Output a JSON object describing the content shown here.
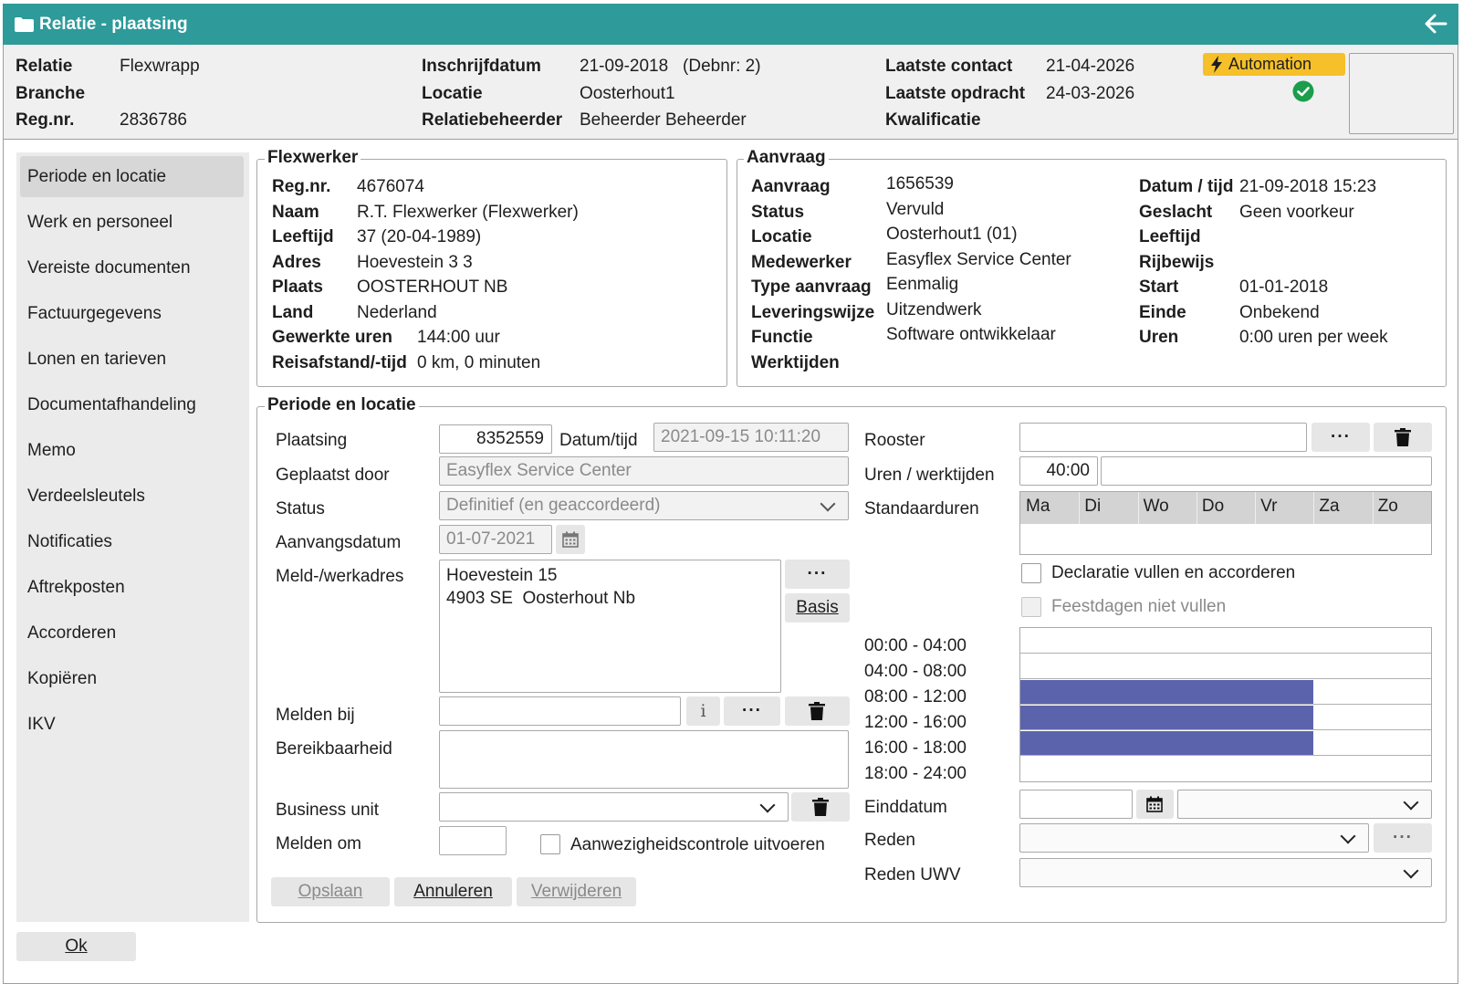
{
  "window": {
    "title": "Relatie - plaatsing"
  },
  "header": {
    "relatie_label": "Relatie",
    "relatie_value": "Flexwrapp",
    "branche_label": "Branche",
    "regnr_label": "Reg.nr.",
    "regnr_value": "2836786",
    "inschrijf_label": "Inschrijfdatum",
    "inschrijf_value": "21-09-2018   (Debnr: 2)",
    "locatie_label": "Locatie",
    "locatie_value": "Oosterhout1",
    "beheerder_label": "Relatiebeheerder",
    "beheerder_value": "Beheerder Beheerder",
    "contact_label": "Laatste contact",
    "contact_value": "21-04-2026",
    "opdracht_label": "Laatste opdracht",
    "opdracht_value": "24-03-2026",
    "kwalificatie_label": "Kwalificatie",
    "automation_label": "Automation"
  },
  "sidebar": {
    "items": [
      {
        "label": "Periode en locatie"
      },
      {
        "label": "Werk en personeel"
      },
      {
        "label": "Vereiste documenten"
      },
      {
        "label": "Factuurgegevens"
      },
      {
        "label": "Lonen en tarieven"
      },
      {
        "label": "Documentafhandeling"
      },
      {
        "label": "Memo"
      },
      {
        "label": "Verdeelsleutels"
      },
      {
        "label": "Notificaties"
      },
      {
        "label": "Aftrekposten"
      },
      {
        "label": "Accorderen"
      },
      {
        "label": "Kopiëren"
      },
      {
        "label": "IKV"
      }
    ]
  },
  "flexwerker": {
    "legend": "Flexwerker",
    "rows": [
      {
        "label": "Reg.nr.",
        "value": "4676074"
      },
      {
        "label": "Naam",
        "value": "R.T. Flexwerker (Flexwerker)"
      },
      {
        "label": "Leeftijd",
        "value": "37 (20-04-1989)"
      },
      {
        "label": "Adres",
        "value": "Hoevestein 3 3"
      },
      {
        "label": "Plaats",
        "value": "OOSTERHOUT NB"
      },
      {
        "label": "Land",
        "value": "Nederland"
      },
      {
        "label": "Gewerkte uren",
        "value": "144:00 uur"
      },
      {
        "label": "Reisafstand/-tijd",
        "value": "0 km, 0 minuten"
      }
    ]
  },
  "aanvraag": {
    "legend": "Aanvraag",
    "left": [
      {
        "label": "Aanvraag",
        "value": "1656539"
      },
      {
        "label": "Status",
        "value": "Vervuld"
      },
      {
        "label": "Locatie",
        "value": "Oosterhout1 (01)"
      },
      {
        "label": "Medewerker",
        "value": "Easyflex Service Center"
      },
      {
        "label": "Type aanvraag",
        "value": "Eenmalig"
      },
      {
        "label": "Leveringswijze",
        "value": "Uitzendwerk"
      },
      {
        "label": "Functie",
        "value": "Software ontwikkelaar"
      },
      {
        "label": "Werktijden",
        "value": ""
      }
    ],
    "right": [
      {
        "label": "Datum / tijd",
        "value": "21-09-2018 15:23"
      },
      {
        "label": "Geslacht",
        "value": "Geen voorkeur"
      },
      {
        "label": "Leeftijd",
        "value": ""
      },
      {
        "label": "Rijbewijs",
        "value": ""
      },
      {
        "label": "Start",
        "value": "01-01-2018"
      },
      {
        "label": "Einde",
        "value": "Onbekend"
      },
      {
        "label": "Uren",
        "value": "0:00 uren per week"
      }
    ]
  },
  "periode": {
    "legend": "Periode en locatie",
    "plaatsing_label": "Plaatsing",
    "plaatsing_value": "8352559",
    "datumtijd_label": "Datum/tijd",
    "datumtijd_value": "2021-09-15 10:11:20",
    "geplaatst_label": "Geplaatst door",
    "geplaatst_value": "Easyflex Service Center",
    "status_label": "Status",
    "status_value": "Definitief (en geaccordeerd)",
    "aanvangs_label": "Aanvangsdatum",
    "aanvangs_value": "01-07-2021",
    "meldadres_label": "Meld-/werkadres",
    "meldadres_line1": "Hoevestein 15",
    "meldadres_line2": "4903 SE  Oosterhout Nb",
    "basis_label": "Basis",
    "melden_bij_label": "Melden bij",
    "bereik_label": "Bereikbaarheid",
    "business_label": "Business unit",
    "melden_om_label": "Melden om",
    "aanwezig_label": "Aanwezigheidscontrole uitvoeren",
    "opslaan_label": "Opslaan",
    "annuleren_label": "Annuleren",
    "verwijderen_label": "Verwijderen",
    "rooster_label": "Rooster",
    "uren_label": "Uren / werktijden",
    "uren_value": "40:00",
    "standaard_label": "Standaarduren",
    "days": [
      "Ma",
      "Di",
      "Wo",
      "Do",
      "Vr",
      "Za",
      "Zo"
    ],
    "declaratie_label": "Declaratie vullen en accorderen",
    "feestdagen_label": "Feestdagen niet vullen",
    "time_slots": [
      {
        "label": "00:00 - 04:00",
        "filled_days": 0
      },
      {
        "label": "04:00 - 08:00",
        "filled_days": 0
      },
      {
        "label": "08:00 - 12:00",
        "filled_days": 5
      },
      {
        "label": "12:00 - 16:00",
        "filled_days": 5
      },
      {
        "label": "16:00 - 18:00",
        "filled_days": 5
      },
      {
        "label": "18:00 - 24:00",
        "filled_days": 0
      }
    ],
    "einddatum_label": "Einddatum",
    "reden_label": "Reden",
    "reden_uwv_label": "Reden UWV",
    "ellipsis": "···"
  },
  "footer": {
    "ok_label": "Ok"
  },
  "colors": {
    "titlebar": "#2e9a9a",
    "automation": "#f6c02a",
    "schedule_fill": "#5c63ad",
    "check_ok": "#1a9e4b"
  }
}
